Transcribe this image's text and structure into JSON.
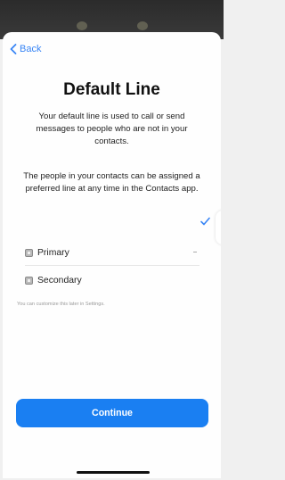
{
  "nav": {
    "back_label": "Back"
  },
  "title": "Default Line",
  "description_1": "Your default line is used to call or send messages to people who are not in your contacts.",
  "description_2": "The people in your contacts can be assigned a preferred line at any time in the Contacts app.",
  "lines": [
    {
      "label": "Primary",
      "selected": true
    },
    {
      "label": "Secondary",
      "selected": false
    }
  ],
  "footnote": "You can customize this later in Settings.",
  "continue_label": "Continue",
  "colors": {
    "accent": "#1a7ff2",
    "link": "#3a86f5"
  },
  "icons": {
    "back": "chevron-left-icon",
    "check": "checkmark-icon",
    "sim": "sim-card-icon"
  }
}
